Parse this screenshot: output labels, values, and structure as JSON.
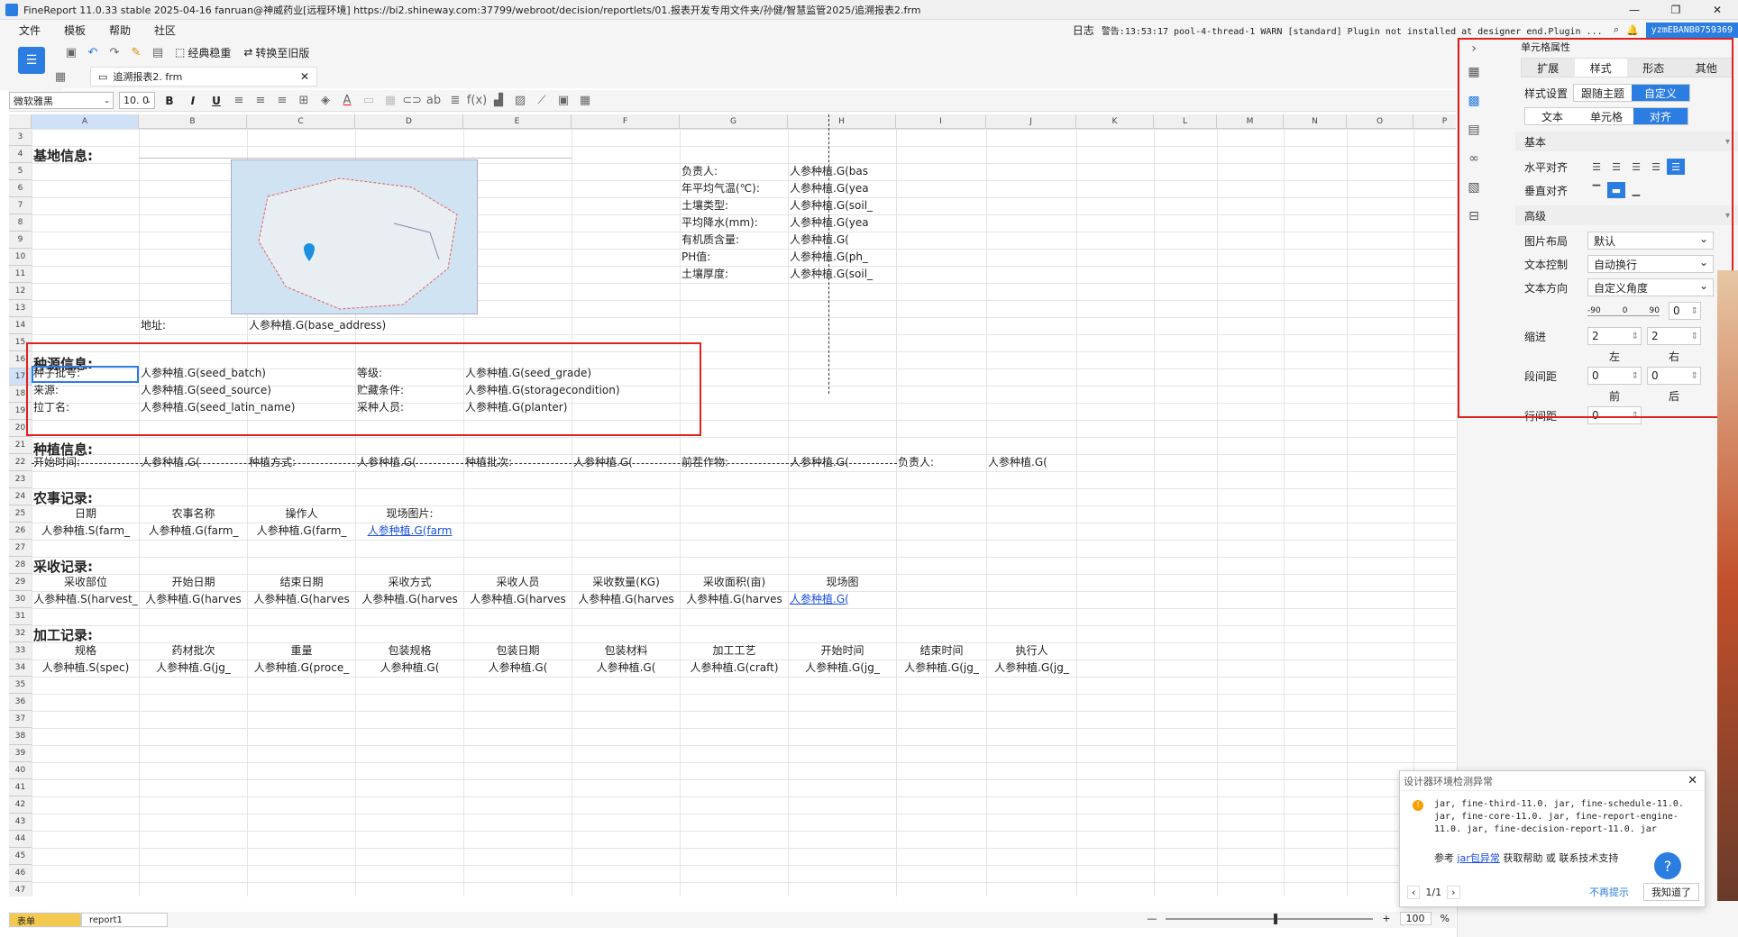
{
  "titlebar": {
    "title": "FineReport 11.0.33 stable 2025-04-16 fanruan@神威药业[远程环境]   https://bi2.shineway.com:37799/webroot/decision/reportlets/01.报表开发专用文件夹/孙健/智慧监管2025/追溯报表2.frm"
  },
  "menubar": {
    "items": [
      "文件",
      "模板",
      "帮助",
      "社区"
    ],
    "log": "日志",
    "warning": "警告:13:53:17 pool-4-thread-1 WARN [standard] Plugin not installed at designer end.Plugin ...",
    "user": "yzmEBANB0759369"
  },
  "toolbar": {
    "classic_label": "经典稳重",
    "convert_label": "转换至旧版"
  },
  "filetab": {
    "name": "追溯报表2. frm"
  },
  "format": {
    "font": "微软雅黑",
    "size": "10. 0"
  },
  "columns": [
    "A",
    "B",
    "C",
    "D",
    "E",
    "F",
    "G",
    "H",
    "I",
    "J",
    "K",
    "L",
    "M",
    "N",
    "O",
    "P"
  ],
  "rows": [
    "3",
    "4",
    "5",
    "6",
    "7",
    "8",
    "9",
    "10",
    "11",
    "12",
    "13",
    "14",
    "15",
    "16",
    "17",
    "18",
    "19",
    "20",
    "21",
    "22",
    "23",
    "24",
    "25",
    "26",
    "27",
    "28",
    "29",
    "30",
    "31",
    "32",
    "33",
    "34",
    "35",
    "36",
    "37",
    "38",
    "39",
    "40",
    "41",
    "42",
    "43",
    "44",
    "45",
    "46",
    "47"
  ],
  "sections": {
    "base": "基地信息:",
    "seed": "种源信息:",
    "plant": "种植信息:",
    "farm": "农事记录:",
    "harvest": "采收记录:",
    "process": "加工记录:"
  },
  "base_fields": [
    {
      "label": "负责人:",
      "value": "人参种植.G(bas"
    },
    {
      "label": "年平均气温(℃):",
      "value": "人参种植.G(yea"
    },
    {
      "label": "土壤类型:",
      "value": "人参种植.G(soil_"
    },
    {
      "label": "平均降水(mm):",
      "value": "人参种植.G(yea"
    },
    {
      "label": "有机质含量:",
      "value": "人参种植.G("
    },
    {
      "label": "PH值:",
      "value": "人参种植.G(ph_"
    },
    {
      "label": "土壤厚度:",
      "value": "人参种植.G(soil_"
    }
  ],
  "address": {
    "label": "地址:",
    "value": "人参种植.G(base_address)"
  },
  "seed_rows": [
    {
      "l1": "种子批号:",
      "v1": "人参种植.G(seed_batch)",
      "l2": "等级:",
      "v2": "人参种植.G(seed_grade)"
    },
    {
      "l1": "来源:",
      "v1": "人参种植.G(seed_source)",
      "l2": "贮藏条件:",
      "v2": "人参种植.G(storagecondition)"
    },
    {
      "l1": "拉丁名:",
      "v1": "人参种植.G(seed_latin_name)",
      "l2": "采种人员:",
      "v2": "人参种植.G(planter)"
    }
  ],
  "plant_row": [
    "开始时间:",
    "人参种植.G(",
    "种植方式:",
    "人参种植.G(",
    "种植批次:",
    "人参种植.G(",
    "前茬作物:",
    "人参种植.G(",
    "负责人:",
    "人参种植.G("
  ],
  "farm_headers": [
    "日期",
    "农事名称",
    "操作人",
    "现场图片:"
  ],
  "farm_values": [
    "人参种植.S(farm_",
    "人参种植.G(farm_",
    "人参种植.G(farm_",
    "人参种植.G(farm"
  ],
  "harvest_headers": [
    "采收部位",
    "开始日期",
    "结束日期",
    "采收方式",
    "采收人员",
    "采收数量(KG)",
    "采收面积(亩)",
    "现场图"
  ],
  "harvest_values": [
    "人参种植.S(harvest_",
    "人参种植.G(harves",
    "人参种植.G(harves",
    "人参种植.G(harves",
    "人参种植.G(harves",
    "人参种植.G(harves",
    "人参种植.G(harves",
    "人参种植.G("
  ],
  "process_headers": [
    "规格",
    "药材批次",
    "重量",
    "包装规格",
    "包装日期",
    "包装材料",
    "加工工艺",
    "开始时间",
    "结束时间",
    "执行人"
  ],
  "process_values": [
    "人参种植.S(spec)",
    "人参种植.G(jg_",
    "人参种植.G(proce_",
    "人参种植.G(",
    "人参种植.G(",
    "人参种植.G(",
    "人参种植.G(craft)",
    "人参种植.G(jg_",
    "人参种植.G(jg_",
    "人参种植.G(jg_"
  ],
  "sheettabs": {
    "form": "表单",
    "report": "report1"
  },
  "zoom": {
    "value": "100",
    "unit": "%"
  },
  "props": {
    "title": "单元格属性",
    "tabs": [
      "扩展",
      "样式",
      "形态",
      "其他"
    ],
    "style_label": "样式设置",
    "style_opts": [
      "跟随主题",
      "自定义"
    ],
    "sub_tabs": [
      "文本",
      "单元格",
      "对齐"
    ],
    "basic": "基本",
    "halign": "水平对齐",
    "valign": "垂直对齐",
    "advanced": "高级",
    "img_layout": "图片布局",
    "img_layout_val": "默认",
    "text_ctrl": "文本控制",
    "text_ctrl_val": "自动换行",
    "text_dir": "文本方向",
    "text_dir_val": "自定义角度",
    "angle_min": "-90",
    "angle_mid": "0",
    "angle_max": "90",
    "angle_val": "0",
    "indent": "缩进",
    "indent_left": "2",
    "indent_right": "2",
    "left": "左",
    "right": "右",
    "para": "段间距",
    "para_before": "0",
    "para_after": "0",
    "before": "前",
    "after": "后",
    "line": "行间距",
    "line_val": "0"
  },
  "popup": {
    "title": "设计器环境检测异常",
    "body": "jar, fine-third-11.0. jar, fine-schedule-11.0. jar, fine-core-11.0. jar, fine-report-engine-11.0. jar, fine-decision-report-11.0. jar",
    "ref": "参考",
    "ref_link": "jar包异常",
    "ref_rest": "获取帮助 或 联系技术支持",
    "page": "1/1",
    "no_more": "不再提示",
    "ok": "我知道了"
  }
}
